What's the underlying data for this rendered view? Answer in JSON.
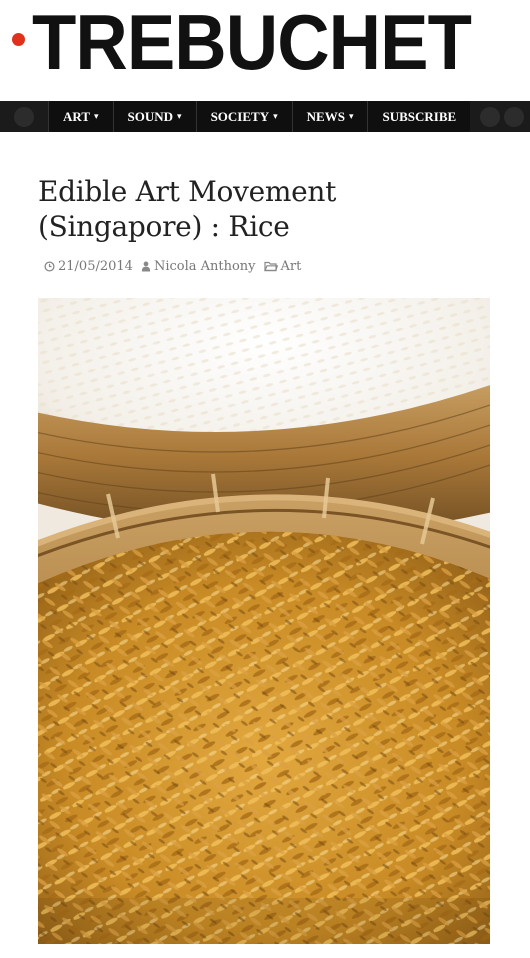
{
  "site": {
    "logo_text": "TREBUCHET",
    "accent_color": "#e0311f"
  },
  "nav": {
    "items": [
      {
        "label": "ART",
        "has_dropdown": true
      },
      {
        "label": "SOUND",
        "has_dropdown": true
      },
      {
        "label": "SOCIETY",
        "has_dropdown": true
      },
      {
        "label": "NEWS",
        "has_dropdown": true
      },
      {
        "label": "SUBSCRIBE",
        "has_dropdown": false
      }
    ],
    "chevron": "▾"
  },
  "article": {
    "title": "Edible Art Movement (Singapore) : Rice",
    "date": "21/05/2014",
    "author": "Nicola Anthony",
    "category": "Art",
    "image": {
      "subject": "Baskets of polished white rice and golden unhusked paddy rice"
    }
  },
  "icons": {
    "date": "clock-icon",
    "author": "user-icon",
    "category": "folder-icon"
  }
}
